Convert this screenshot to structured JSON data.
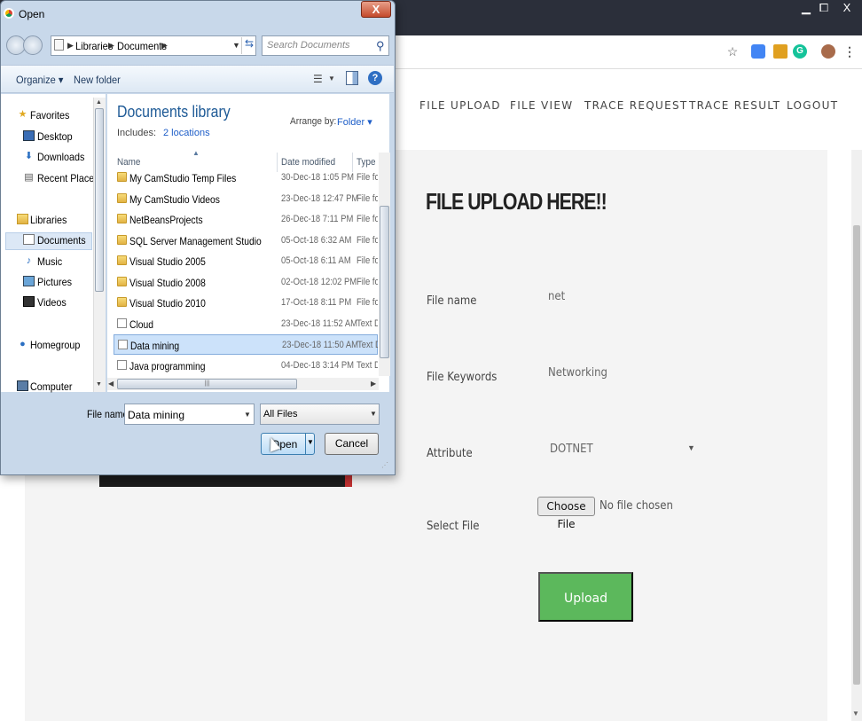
{
  "browser": {
    "window_controls": {
      "minimize": "▁",
      "maximize": "⧠",
      "close": "X"
    },
    "extensions": {
      "star": "☆",
      "g": "G",
      "menu": "⋮"
    }
  },
  "site": {
    "nav": [
      "FILE UPLOAD",
      "FILE VIEW",
      "TRACE REQUEST",
      "TRACE RESULT",
      "LOGOUT"
    ],
    "heading": "FILE UPLOAD HERE!!",
    "form": {
      "file_name_label": "File name",
      "file_name_value": "net",
      "keywords_label": "File Keywords",
      "keywords_value": "Networking",
      "attribute_label": "Attribute",
      "attribute_value": "DOTNET",
      "select_file_label": "Select File",
      "choose_file_button": "Choose File",
      "no_file_text": "No file chosen",
      "upload_button": "Upload"
    },
    "accent_color": "#5cb85c"
  },
  "dialog": {
    "title": "Open",
    "close": "X",
    "breadcrumb": [
      "Libraries",
      "Documents"
    ],
    "search_placeholder": "Search Documents",
    "toolbar": {
      "organize": "Organize ▾",
      "new_folder": "New folder",
      "help": "?"
    },
    "nav": {
      "favorites_header": "Favorites",
      "favorites": [
        "Desktop",
        "Downloads",
        "Recent Places"
      ],
      "libraries_header": "Libraries",
      "libraries": [
        "Documents",
        "Music",
        "Pictures",
        "Videos"
      ],
      "selected": "Documents",
      "homegroup": "Homegroup",
      "computer": "Computer"
    },
    "library": {
      "title": "Documents library",
      "includes": "Includes:",
      "locations": "2 locations",
      "arrange_label": "Arrange by:",
      "arrange_value": "Folder ▾"
    },
    "columns": [
      "Name",
      "Date modified",
      "Type"
    ],
    "files": [
      {
        "name": "My CamStudio Temp Files",
        "date": "30-Dec-18 1:05 PM",
        "type": "File fol",
        "kind": "folder"
      },
      {
        "name": "My CamStudio Videos",
        "date": "23-Dec-18 12:47 PM",
        "type": "File fol",
        "kind": "folder"
      },
      {
        "name": "NetBeansProjects",
        "date": "26-Dec-18 7:11 PM",
        "type": "File fol",
        "kind": "folder"
      },
      {
        "name": "SQL Server Management Studio",
        "date": "05-Oct-18 6:32 AM",
        "type": "File fol",
        "kind": "folder"
      },
      {
        "name": "Visual Studio 2005",
        "date": "05-Oct-18 6:11 AM",
        "type": "File fol",
        "kind": "folder"
      },
      {
        "name": "Visual Studio 2008",
        "date": "02-Oct-18 12:02 PM",
        "type": "File fol",
        "kind": "folder"
      },
      {
        "name": "Visual Studio 2010",
        "date": "17-Oct-18 8:11 PM",
        "type": "File fol",
        "kind": "folder"
      },
      {
        "name": "Cloud",
        "date": "23-Dec-18 11:52 AM",
        "type": "Text D",
        "kind": "doc"
      },
      {
        "name": "Data mining",
        "date": "23-Dec-18 11:50 AM",
        "type": "Text D",
        "kind": "doc",
        "selected": true
      },
      {
        "name": "Java programming",
        "date": "04-Dec-18 3:14 PM",
        "type": "Text D",
        "kind": "doc"
      }
    ],
    "file_name_label": "File name:",
    "file_name_value": "Data mining",
    "file_type_value": "All Files",
    "open_button": "Open",
    "cancel_button": "Cancel"
  }
}
